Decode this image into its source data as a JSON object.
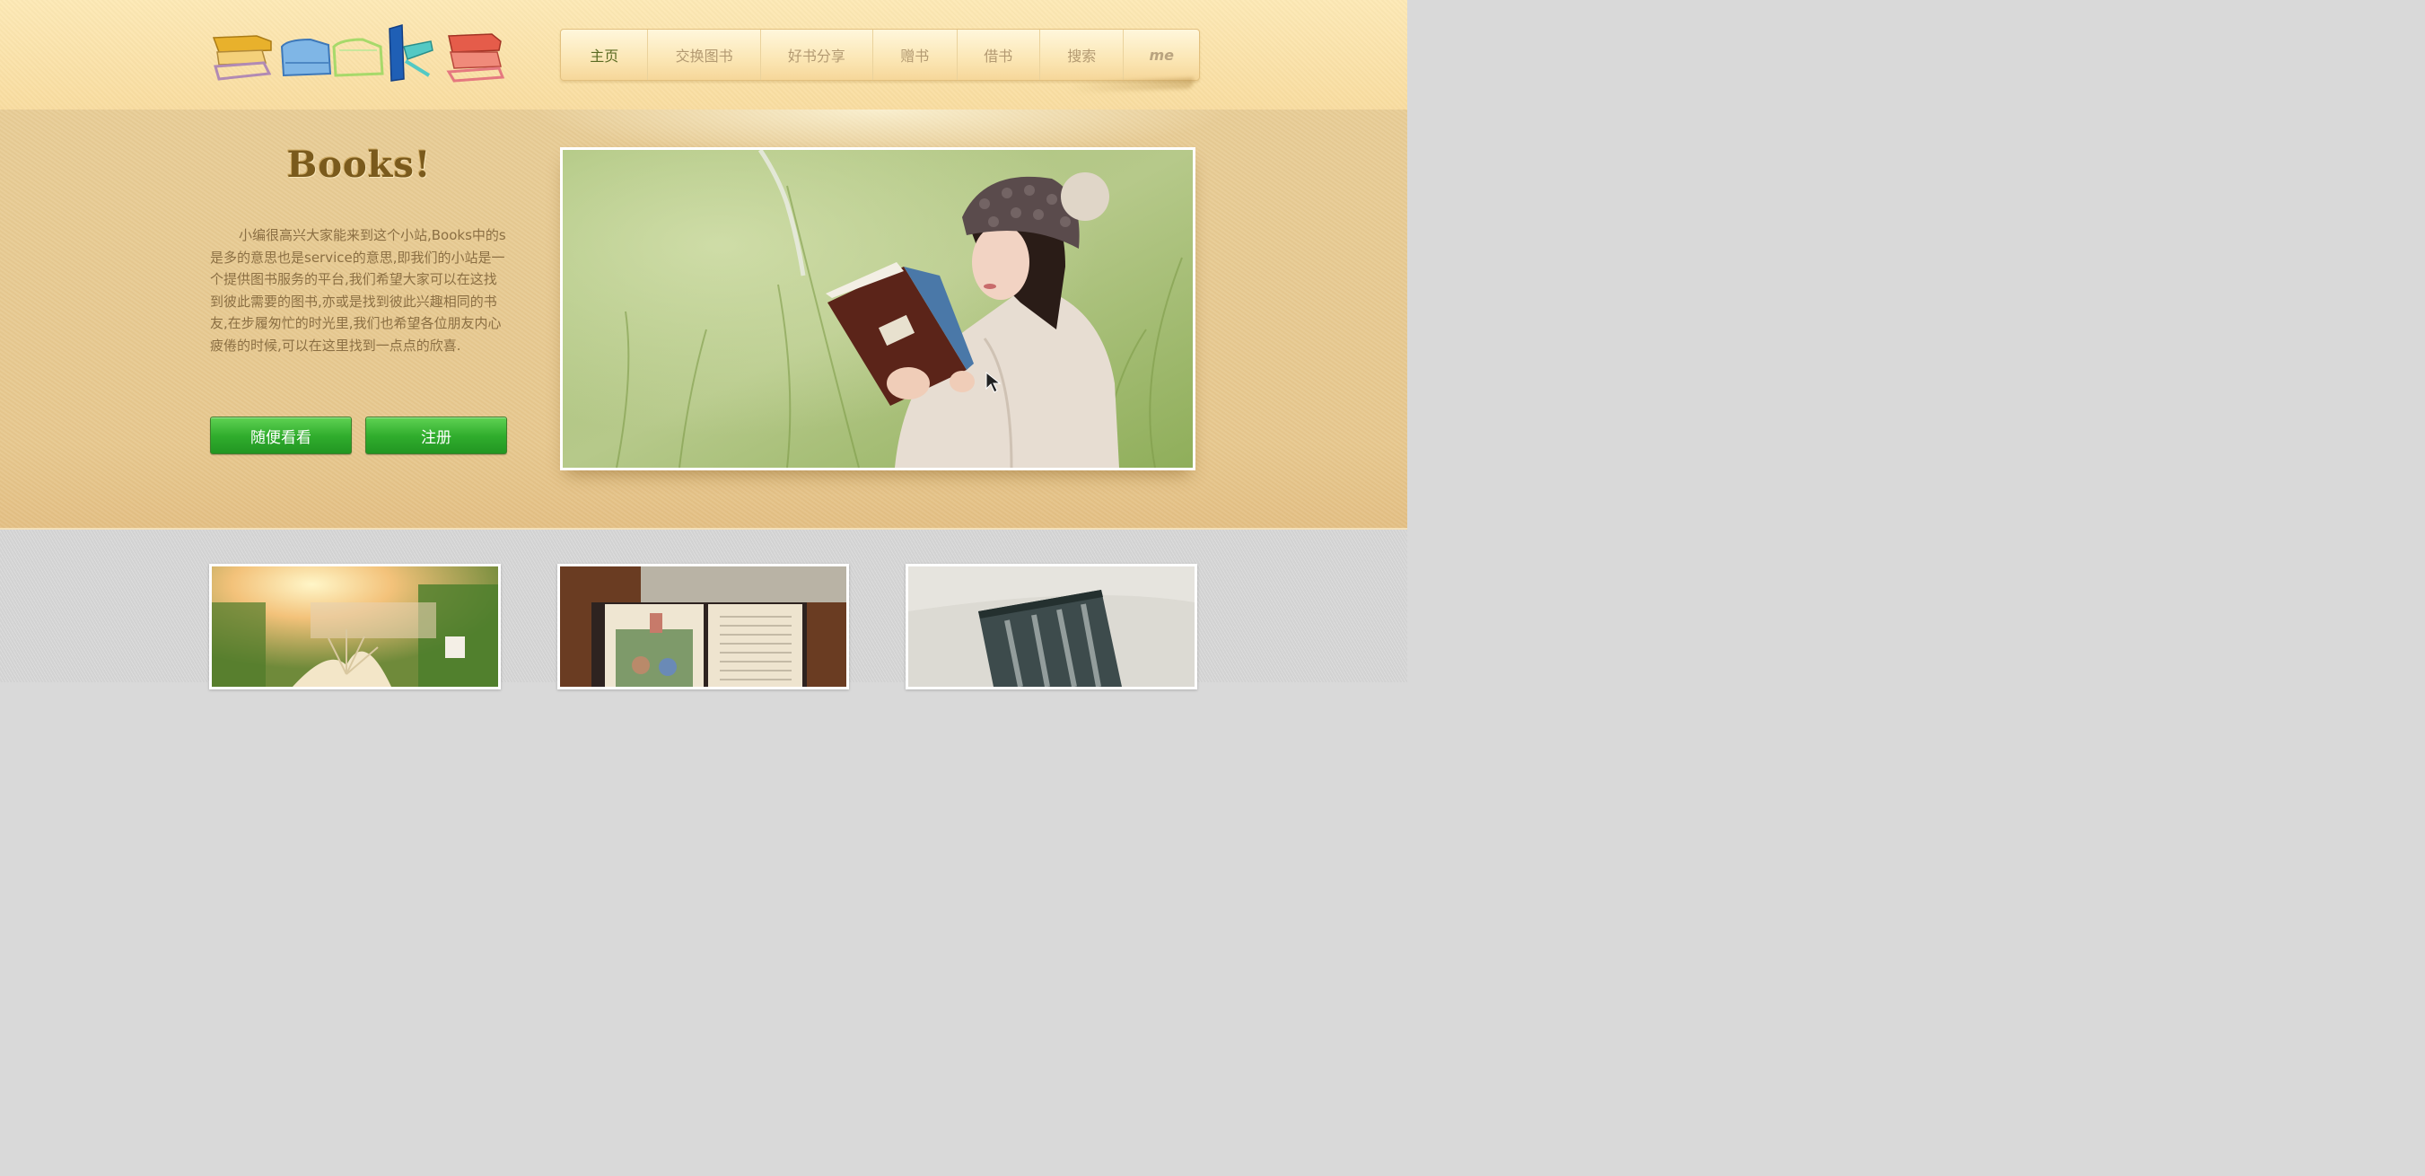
{
  "header": {
    "logo_text": "Books",
    "nav": [
      {
        "label": "主页",
        "active": true
      },
      {
        "label": "交换图书"
      },
      {
        "label": "好书分享"
      },
      {
        "label": "赠书"
      },
      {
        "label": "借书"
      },
      {
        "label": "搜索"
      },
      {
        "label": "me"
      }
    ]
  },
  "hero": {
    "title": "Books!",
    "description": "小编很高兴大家能来到这个小站,Books中的s是多的意思也是service的意思,即我们的小站是一个提供图书服务的平台,我们希望大家可以在这找到彼此需要的图书,亦或是找到彼此兴趣相同的书友,在步履匆忙的时光里,我们也希望各位朋友内心疲倦的时候,可以在这里找到一点点的欣喜.",
    "buttons": {
      "browse": "随便看看",
      "register": "注册"
    }
  },
  "colors": {
    "header_bg": "#fbe3a9",
    "hero_bg": "#e8cc95",
    "bottom_bg": "#d6d6d6",
    "button_green": "#30ad2d",
    "nav_active": "#5a6a22",
    "nav_text": "#b39a72",
    "title_brown": "#7a5a1c"
  }
}
